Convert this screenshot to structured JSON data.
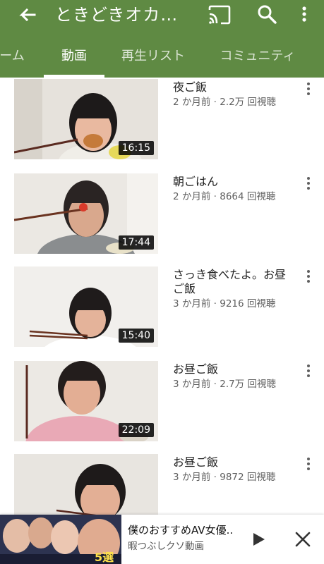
{
  "header": {
    "title": "ときどきオカ…",
    "icons": {
      "back": "back-arrow-icon",
      "cast": "cast-icon",
      "search": "search-icon",
      "more": "more-vert-icon"
    },
    "bg_color": "#5f8a43"
  },
  "tabs": [
    {
      "label": "ーム"
    },
    {
      "label": "動画",
      "active": true
    },
    {
      "label": "再生リスト"
    },
    {
      "label": "コミュニティ"
    }
  ],
  "videos": [
    {
      "title": "夜ご飯",
      "meta": "2 か月前 · 2.2万 回視聴",
      "duration": "16:15"
    },
    {
      "title": "朝ごはん",
      "meta": "2 か月前 · 8664 回視聴",
      "duration": "17:44"
    },
    {
      "title": "さっき食べたよ。お昼ご飯",
      "meta": "3 か月前 · 9216 回視聴",
      "duration": "15:40"
    },
    {
      "title": "お昼ご飯",
      "meta": "3 か月前 · 2.7万 回視聴",
      "duration": "22:09"
    },
    {
      "title": "お昼ご飯",
      "meta": "3 か月前 · 9872 回視聴",
      "duration": ""
    }
  ],
  "ad": {
    "title": "僕のおすすめAV女優..",
    "subtitle": "暇つぶしクソ動画",
    "image_text": "5選"
  }
}
